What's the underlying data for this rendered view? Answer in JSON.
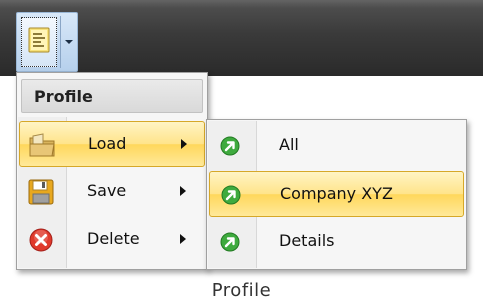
{
  "toolbar": {
    "profile_button_icon": "profile-document-icon",
    "dropdown_icon": "chevron-down-icon"
  },
  "menu": {
    "header": "Profile",
    "items": [
      {
        "label": "Load",
        "icon": "folder-icon",
        "highlighted": true
      },
      {
        "label": "Save",
        "icon": "floppy-disk-icon",
        "highlighted": false
      },
      {
        "label": "Delete",
        "icon": "delete-icon",
        "highlighted": false
      }
    ]
  },
  "submenu": {
    "items": [
      {
        "label": "All",
        "icon": "green-arrow-icon",
        "highlighted": false
      },
      {
        "label": "Company XYZ",
        "icon": "green-arrow-icon",
        "highlighted": true
      },
      {
        "label": "Details",
        "icon": "green-arrow-icon",
        "highlighted": false
      }
    ]
  },
  "caption": "Profile",
  "colors": {
    "highlight": "#ffe48a",
    "highlight_border": "#d6a829",
    "toolbar_bg": "#3a3a3a",
    "button_bg": "#b6d0ec"
  }
}
